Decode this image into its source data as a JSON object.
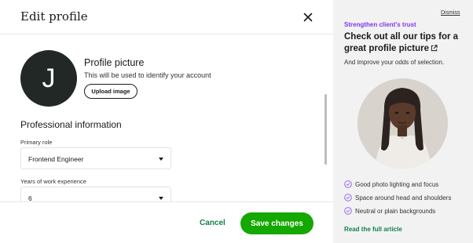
{
  "modal": {
    "title": "Edit profile"
  },
  "profile_picture": {
    "initial": "J",
    "title": "Profile picture",
    "description": "This will be used to identify your account",
    "upload_label": "Upload image"
  },
  "professional": {
    "section_title": "Professional information",
    "primary_role_label": "Primary role",
    "primary_role_value": "Frontend Engineer",
    "years_label": "Years of work experience",
    "years_value": "6"
  },
  "footer": {
    "cancel_label": "Cancel",
    "save_label": "Save changes"
  },
  "tips": {
    "dismiss_label": "Dismiss",
    "eyebrow": "Strengthen client's trust",
    "title": "Check out all our tips for a great profile picture",
    "subtitle": "And improve your odds of selection.",
    "items": [
      "Good photo lighting and focus",
      "Space around head and shoulders",
      "Neutral or plain backgrounds"
    ],
    "read_link": "Read the full article"
  },
  "colors": {
    "accent_green": "#14a800",
    "link_green": "#14804a",
    "eyebrow_purple": "#7c3aed",
    "avatar_bg": "#222826",
    "tips_bg": "#f2f2f2"
  },
  "icons": [
    "close-icon",
    "caret-down-icon",
    "external-link-icon",
    "check-circle-icon"
  ]
}
